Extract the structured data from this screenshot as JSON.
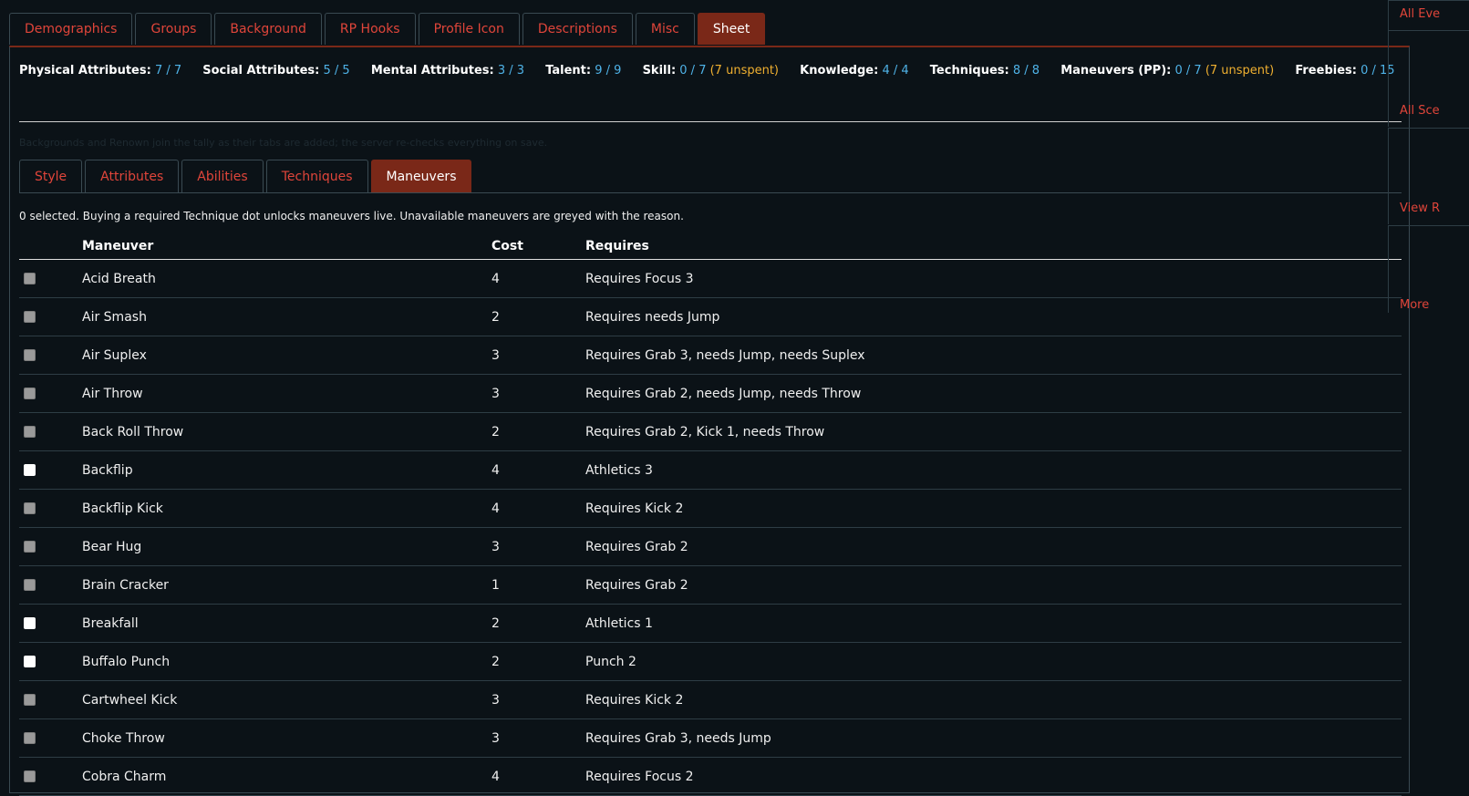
{
  "tabs": [
    "Demographics",
    "Groups",
    "Background",
    "RP Hooks",
    "Profile Icon",
    "Descriptions",
    "Misc",
    "Sheet"
  ],
  "summary": [
    {
      "label": "Physical Attributes:",
      "value": "7 / 7",
      "unspent": ""
    },
    {
      "label": "Social Attributes:",
      "value": "5 / 5",
      "unspent": ""
    },
    {
      "label": "Mental Attributes:",
      "value": "3 / 3",
      "unspent": ""
    },
    {
      "label": "Talent:",
      "value": "9 / 9",
      "unspent": ""
    },
    {
      "label": "Skill:",
      "value": "0 / 7",
      "unspent": "(7 unspent)"
    },
    {
      "label": "Knowledge:",
      "value": "4 / 4",
      "unspent": ""
    },
    {
      "label": "Techniques:",
      "value": "8 / 8",
      "unspent": ""
    },
    {
      "label": "Maneuvers (PP):",
      "value": "0 / 7",
      "unspent": "(7 unspent)"
    },
    {
      "label": "Freebies:",
      "value": "0 / 15",
      "unspent": ""
    }
  ],
  "hint": "Backgrounds and Renown join the tally as their tabs are added; the server re-checks everything on save.",
  "subtabs": [
    "Style",
    "Attributes",
    "Abilities",
    "Techniques",
    "Maneuvers"
  ],
  "info": "0 selected. Buying a required Technique dot unlocks maneuvers live. Unavailable maneuvers are greyed with the reason.",
  "table": {
    "headers": {
      "name": "Maneuver",
      "cost": "Cost",
      "requires": "Requires"
    },
    "rows": [
      {
        "name": "Acid Breath",
        "cost": "4",
        "requires": "Requires Focus 3",
        "available": false
      },
      {
        "name": "Air Smash",
        "cost": "2",
        "requires": "Requires needs Jump",
        "available": false
      },
      {
        "name": "Air Suplex",
        "cost": "3",
        "requires": "Requires Grab 3, needs Jump, needs Suplex",
        "available": false
      },
      {
        "name": "Air Throw",
        "cost": "3",
        "requires": "Requires Grab 2, needs Jump, needs Throw",
        "available": false
      },
      {
        "name": "Back Roll Throw",
        "cost": "2",
        "requires": "Requires Grab 2, Kick 1, needs Throw",
        "available": false
      },
      {
        "name": "Backflip",
        "cost": "4",
        "requires": "Athletics 3",
        "available": true
      },
      {
        "name": "Backflip Kick",
        "cost": "4",
        "requires": "Requires Kick 2",
        "available": false
      },
      {
        "name": "Bear Hug",
        "cost": "3",
        "requires": "Requires Grab 2",
        "available": false
      },
      {
        "name": "Brain Cracker",
        "cost": "1",
        "requires": "Requires Grab 2",
        "available": false
      },
      {
        "name": "Breakfall",
        "cost": "2",
        "requires": "Athletics 1",
        "available": true
      },
      {
        "name": "Buffalo Punch",
        "cost": "2",
        "requires": "Punch 2",
        "available": true
      },
      {
        "name": "Cartwheel Kick",
        "cost": "3",
        "requires": "Requires Kick 2",
        "available": false
      },
      {
        "name": "Choke Throw",
        "cost": "3",
        "requires": "Requires Grab 3, needs Jump",
        "available": false
      },
      {
        "name": "Cobra Charm",
        "cost": "4",
        "requires": "Requires Focus 2",
        "available": false
      }
    ]
  },
  "sidebar": [
    "All Eve",
    "All Sce",
    "View R",
    "More"
  ],
  "colors": {
    "accent": "#7a2818",
    "link": "#e0453a",
    "value": "#4fb3e8",
    "unspent": "#f0b030",
    "ok": "#3fa860",
    "bad": "#e24a3a"
  }
}
